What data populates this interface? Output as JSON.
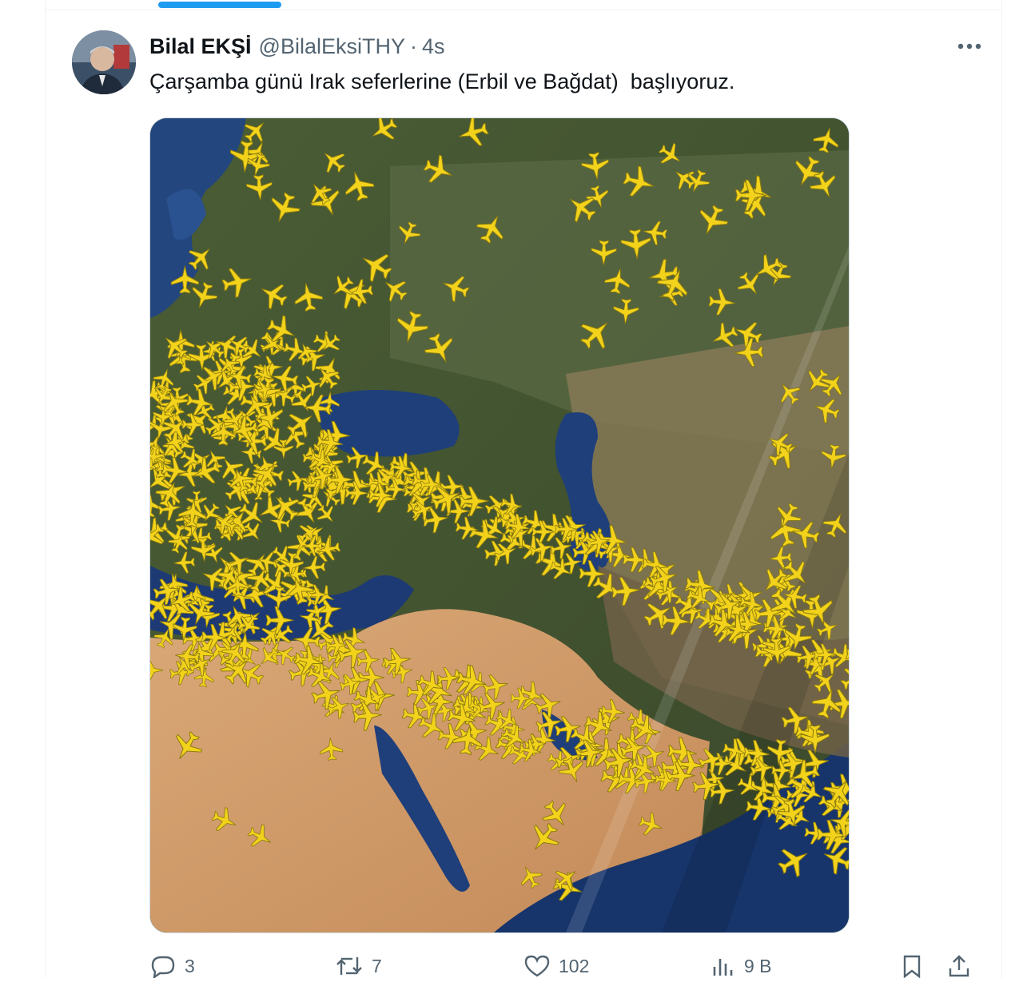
{
  "tweet": {
    "author_name": "Bilal EKŞİ",
    "author_handle": "@BilalEksiTHY",
    "separator": "·",
    "timestamp": "4s",
    "text": "Çarşamba günü Irak seferlerine (Erbil ve Bağdat)  başlıyoruz.",
    "avatar_icon": "user-avatar",
    "more_icon": "more-horizontal-icon",
    "media_description_icon": "flight-map-image"
  },
  "actions": {
    "reply_count": "3",
    "retweet_count": "7",
    "like_count": "102",
    "views_count": "9 B",
    "reply_icon": "reply-icon",
    "retweet_icon": "retweet-icon",
    "like_icon": "heart-icon",
    "views_icon": "views-chart-icon",
    "bookmark_icon": "bookmark-icon",
    "share_icon": "share-icon"
  },
  "colors": {
    "accent": "#1d9bf0",
    "text_primary": "#0f1419",
    "text_secondary": "#536471",
    "plane_yellow": "#f2d21b"
  }
}
